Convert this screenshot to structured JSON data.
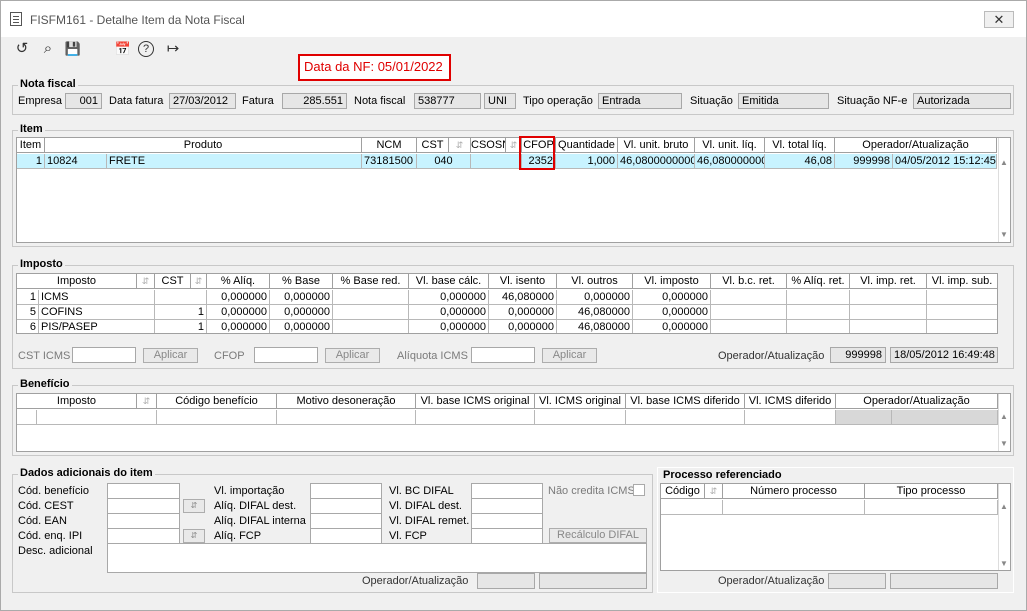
{
  "window": {
    "title": "FISFM161 - Detalhe Item da Nota Fiscal",
    "close": "✕"
  },
  "toolbar": {
    "undo_icon": "↺",
    "search_icon": "⌕",
    "save_icon": "💾",
    "calendar_icon": "📅",
    "help_icon": "?",
    "exit_icon": "↦"
  },
  "warning": {
    "text": "Data da NF: 05/01/2022"
  },
  "nota": {
    "title": "Nota fiscal",
    "empresa_label": "Empresa",
    "empresa": "001",
    "data_fatura_label": "Data fatura",
    "data_fatura": "27/03/2012",
    "fatura_label": "Fatura",
    "fatura": "285.551",
    "nota_label": "Nota fiscal",
    "nota": "538777",
    "serie": "UNI",
    "tipo_label": "Tipo operação",
    "tipo": "Entrada",
    "situacao_label": "Situação",
    "situacao": "Emitida",
    "situacao_nfe_label": "Situação NF-e",
    "situacao_nfe": "Autorizada"
  },
  "item": {
    "title": "Item",
    "headers": [
      "Item",
      "Produto",
      "NCM",
      "CST",
      "CSOSN",
      "CFOP",
      "Quantidade",
      "Vl. unit. bruto",
      "Vl. unit. líq.",
      "Vl. total líq.",
      "Operador/Atualização"
    ],
    "row": {
      "item": "1",
      "codigo": "10824",
      "produto": "FRETE",
      "ncm": "73181500",
      "cst": "040",
      "csosn": "",
      "cfop": "2352",
      "quantidade": "1,000",
      "unit_bruto": "46,0800000000",
      "unit_liq": "46,0800000000",
      "total_liq": "46,08",
      "operador": "999998",
      "atualizacao": "04/05/2012 15:12:45"
    }
  },
  "imposto": {
    "title": "Imposto",
    "headers": [
      "Imposto",
      "CST",
      "% Alíq.",
      "% Base",
      "% Base red.",
      "Vl. base cálc.",
      "Vl. isento",
      "Vl. outros",
      "Vl. imposto",
      "Vl. b.c. ret.",
      "% Alíq. ret.",
      "Vl. imp. ret.",
      "Vl. imp. sub."
    ],
    "rows": [
      {
        "n": "1",
        "imposto": "ICMS",
        "cst": "",
        "aliq": "0,000000",
        "base": "0,000000",
        "base_red": "",
        "base_calc": "0,000000",
        "isento": "46,080000",
        "outros": "0,000000",
        "vl_imposto": "0,000000"
      },
      {
        "n": "5",
        "imposto": "COFINS",
        "cst": "1",
        "aliq": "0,000000",
        "base": "0,000000",
        "base_red": "",
        "base_calc": "0,000000",
        "isento": "0,000000",
        "outros": "46,080000",
        "vl_imposto": "0,000000"
      },
      {
        "n": "6",
        "imposto": "PIS/PASEP",
        "cst": "1",
        "aliq": "0,000000",
        "base": "0,000000",
        "base_red": "",
        "base_calc": "0,000000",
        "isento": "0,000000",
        "outros": "46,080000",
        "vl_imposto": "0,000000"
      }
    ],
    "cst_icms_label": "CST ICMS",
    "cfop_label": "CFOP",
    "aliquota_label": "Alíquota ICMS",
    "aplicar": "Aplicar",
    "operador_label": "Operador/Atualização",
    "operador": "999998",
    "atualizacao": "18/05/2012 16:49:48"
  },
  "beneficio": {
    "title": "Benefício",
    "headers": [
      "Imposto",
      "Código benefício",
      "Motivo desoneração",
      "Vl. base ICMS original",
      "Vl. ICMS original",
      "Vl. base ICMS diferido",
      "Vl. ICMS diferido",
      "Operador/Atualização"
    ]
  },
  "dados": {
    "title": "Dados adicionais do item",
    "cod_beneficio": "Cód. benefício",
    "cod_cest": "Cód. CEST",
    "cod_ean": "Cód. EAN",
    "cod_enq_ipi": "Cód. enq. IPI",
    "desc_adicional": "Desc. adicional",
    "vl_importacao": "Vl. importação",
    "aliq_difal_dest": "Alíq. DIFAL dest.",
    "aliq_difal_interna": "Alíq. DIFAL interna",
    "aliq_fcp": "Alíq. FCP",
    "vl_bc_difal": "Vl. BC DIFAL",
    "vl_difal_dest": "Vl. DIFAL dest.",
    "vl_difal_remet": "Vl. DIFAL remet.",
    "vl_fcp": "Vl. FCP",
    "nao_credita": "Não credita ICMS",
    "recalculo": "Recálculo DIFAL",
    "operador_label": "Operador/Atualização"
  },
  "processo": {
    "title": "Processo referenciado",
    "headers": [
      "Código",
      "Número processo",
      "Tipo processo"
    ],
    "operador_label": "Operador/Atualização"
  }
}
